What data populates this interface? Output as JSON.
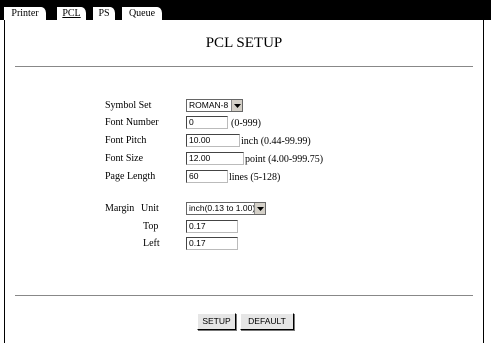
{
  "tabs": [
    {
      "label": "Printer",
      "active": false
    },
    {
      "label": "PCL",
      "active": true
    },
    {
      "label": "PS",
      "active": false
    },
    {
      "label": "Queue",
      "active": false
    }
  ],
  "page_title": "PCL SETUP",
  "form": {
    "symbol_set": {
      "label": "Symbol Set",
      "value": "ROMAN-8"
    },
    "font_number": {
      "label": "Font Number",
      "value": "0",
      "range": "(0-999)"
    },
    "font_pitch": {
      "label": "Font Pitch",
      "value": "10.00",
      "unit": "inch",
      "range": "(0.44-99.99)"
    },
    "font_size": {
      "label": "Font Size",
      "value": "12.00",
      "unit": "point",
      "range": "(4.00-999.75)"
    },
    "page_length": {
      "label": "Page Length",
      "value": "60",
      "unit": "lines",
      "range": "(5-128)"
    },
    "margin": {
      "label": "Margin",
      "unit_label": "Unit",
      "unit_value": "inch(0.13 to 1.00)",
      "top_label": "Top",
      "top_value": "0.17",
      "left_label": "Left",
      "left_value": "0.17"
    }
  },
  "buttons": {
    "setup": "SETUP",
    "default": "DEFAULT"
  },
  "icons": {
    "dropdown": "chevron-down-icon"
  }
}
